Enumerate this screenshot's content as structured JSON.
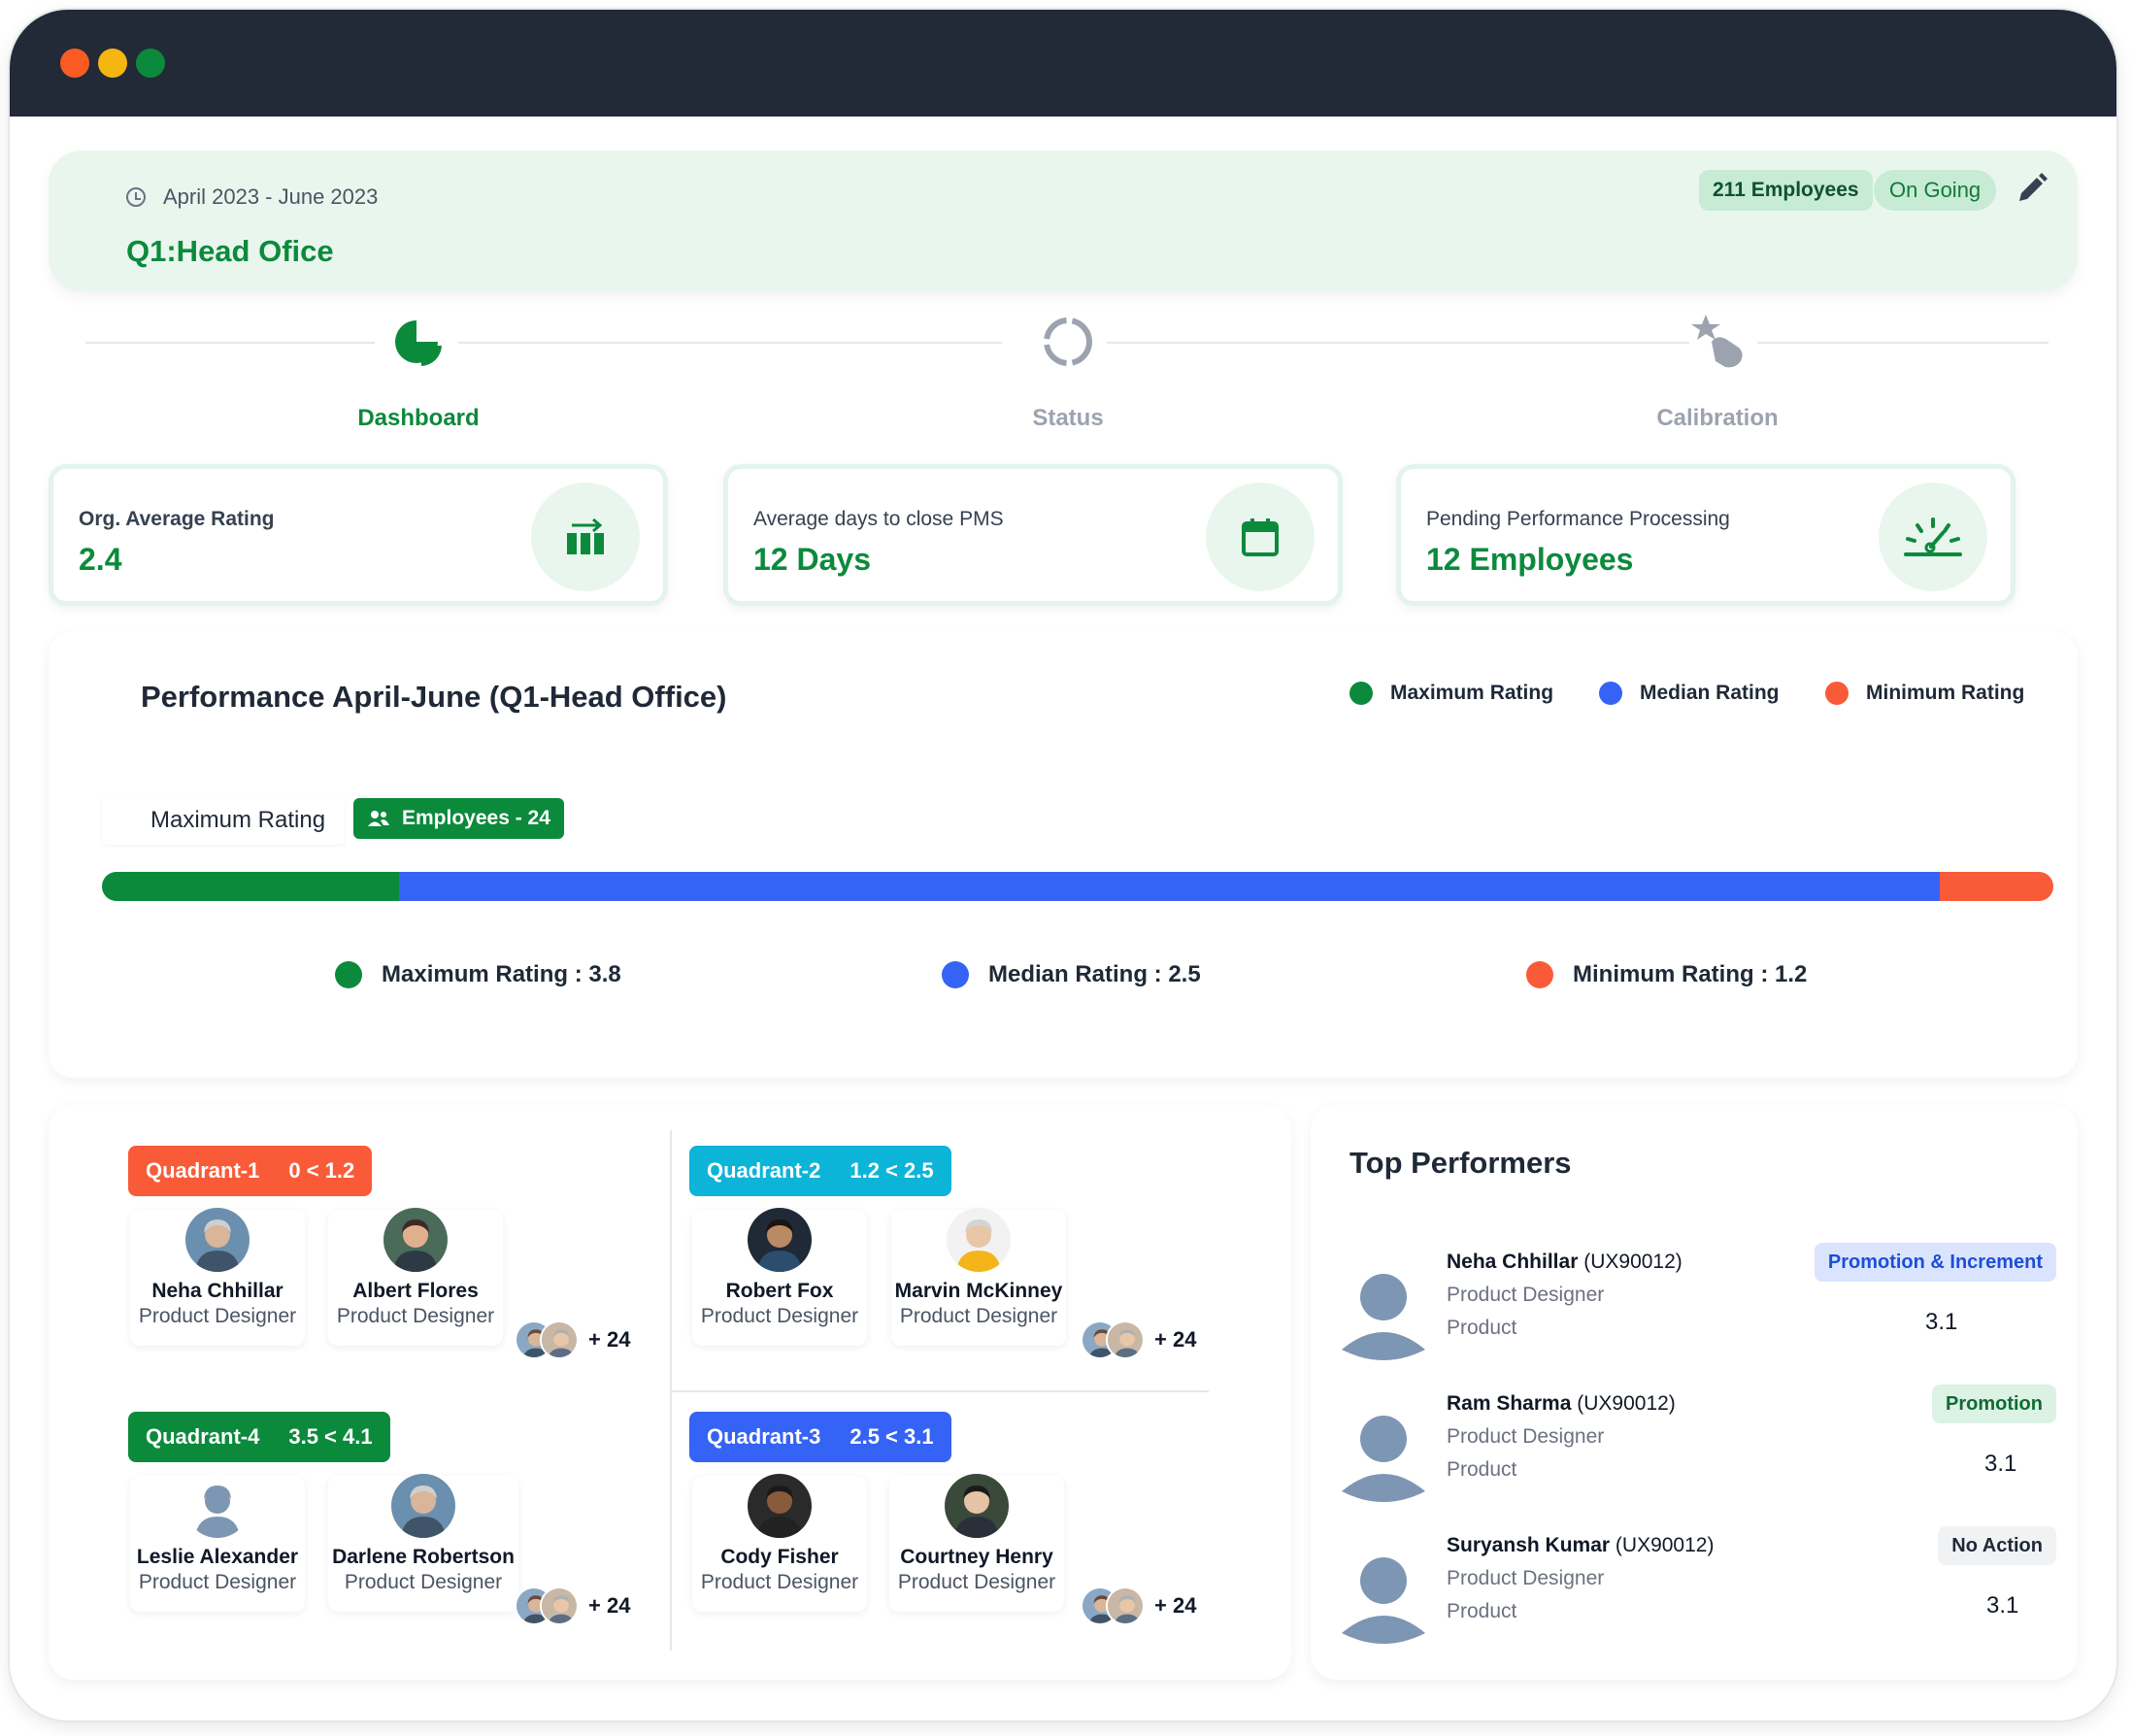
{
  "header": {
    "date_range": "April 2023  -  June 2023",
    "title": "Q1:Head Ofice",
    "employees_badge": "211 Employees",
    "status_badge": "On Going"
  },
  "steps": [
    {
      "label": "Dashboard",
      "icon": "pie-chart-icon",
      "active": true
    },
    {
      "label": "Status",
      "icon": "loading-ring-icon",
      "active": false
    },
    {
      "label": "Calibration",
      "icon": "star-hand-icon",
      "active": false
    }
  ],
  "stats": [
    {
      "label": "Org. Average Rating",
      "value": "2.4",
      "icon": "rating-bars-icon"
    },
    {
      "label": "Average days to close PMS",
      "value": "12 Days",
      "icon": "calendar-icon"
    },
    {
      "label": "Pending Performance Processing",
      "value": "12 Employees",
      "icon": "gauge-icon"
    }
  ],
  "performance": {
    "title": "Performance April-June (Q1-Head Office)",
    "legend": [
      "Maximum Rating",
      "Median Rating",
      "Minimum Rating"
    ],
    "filter_label": "Maximum Rating",
    "employees_pill": "Employees - 24",
    "ratings": [
      {
        "label": "Maximum Rating : 3.8",
        "value": 3.8,
        "color": "#0c8a3c"
      },
      {
        "label": "Median Rating : 2.5",
        "value": 2.5,
        "color": "#3563f5"
      },
      {
        "label": "Minimum Rating : 1.2",
        "value": 1.2,
        "color": "#f95b38"
      }
    ],
    "bar_segments": [
      {
        "name": "maximum",
        "fraction": 0.152,
        "color": "#0c8a3c"
      },
      {
        "name": "median",
        "fraction": 0.79,
        "color": "#3563f5"
      },
      {
        "name": "minimum",
        "fraction": 0.058,
        "color": "#f95b38"
      }
    ]
  },
  "quadrants": [
    {
      "name": "Quadrant-1",
      "range": "0 < 1.2",
      "color": "#f95b38",
      "people": [
        {
          "name": "Neha Chhillar",
          "role": "Product Designer"
        },
        {
          "name": "Albert Flores",
          "role": "Product Designer"
        }
      ],
      "more": "+ 24"
    },
    {
      "name": "Quadrant-2",
      "range": "1.2 < 2.5",
      "color": "#0cb4d8",
      "people": [
        {
          "name": "Robert Fox",
          "role": "Product Designer"
        },
        {
          "name": "Marvin McKinney",
          "role": "Product Designer"
        }
      ],
      "more": "+ 24"
    },
    {
      "name": "Quadrant-4",
      "range": "3.5 < 4.1",
      "color": "#0c8a3c",
      "people": [
        {
          "name": "Leslie Alexander",
          "role": "Product Designer"
        },
        {
          "name": "Darlene Robertson",
          "role": "Product Designer"
        }
      ],
      "more": "+ 24"
    },
    {
      "name": "Quadrant-3",
      "range": "2.5 < 3.1",
      "color": "#3563f5",
      "people": [
        {
          "name": "Cody Fisher",
          "role": "Product Designer"
        },
        {
          "name": "Courtney Henry",
          "role": "Product Designer"
        }
      ],
      "more": "+ 24"
    }
  ],
  "top_performers": {
    "title": "Top Performers",
    "items": [
      {
        "name": "Neha Chhillar",
        "code": "(UX90012)",
        "role": "Product Designer",
        "dept": "Product",
        "tag": "Promotion & Increment",
        "score": "3.1",
        "tag_bg": "#dbe4ff",
        "tag_color": "#1d4ed8"
      },
      {
        "name": "Ram Sharma",
        "code": "(UX90012)",
        "role": "Product Designer",
        "dept": "Product",
        "tag": "Promotion",
        "score": "3.1",
        "tag_bg": "#dcf2e4",
        "tag_color": "#0f6b33"
      },
      {
        "name": "Suryansh Kumar",
        "code": "(UX90012)",
        "role": "Product Designer",
        "dept": "Product",
        "tag": "No Action",
        "score": "3.1",
        "tag_bg": "#f1f2f4",
        "tag_color": "#1f2937"
      }
    ]
  }
}
